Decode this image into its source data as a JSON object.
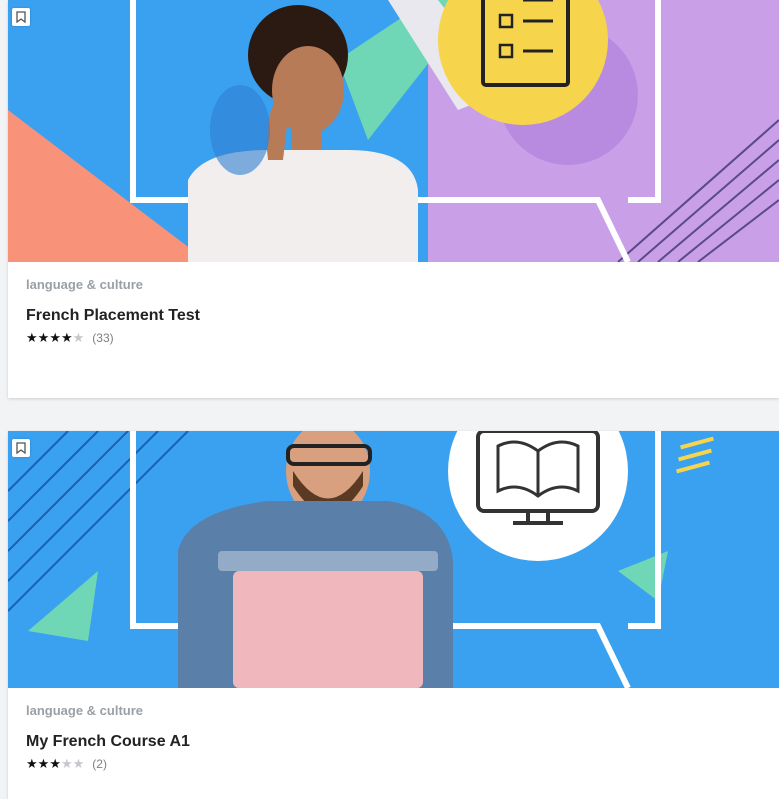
{
  "cards": [
    {
      "category": "language & culture",
      "title": "French Placement Test",
      "rating": 4,
      "rating_max": 5,
      "review_count": "(33)"
    },
    {
      "category": "language & culture",
      "title": "My French Course A1",
      "rating": 3,
      "rating_max": 5,
      "review_count": "(2)"
    }
  ],
  "colors": {
    "banner_blue": "#3aa0f0",
    "accent_yellow": "#f6d44b",
    "accent_purple": "#c9a0e8",
    "accent_coral": "#f8937a",
    "accent_mint": "#6fd7b5"
  },
  "icons": [
    "bookmark-icon",
    "checklist-icon",
    "book-screen-icon",
    "star-icon"
  ]
}
